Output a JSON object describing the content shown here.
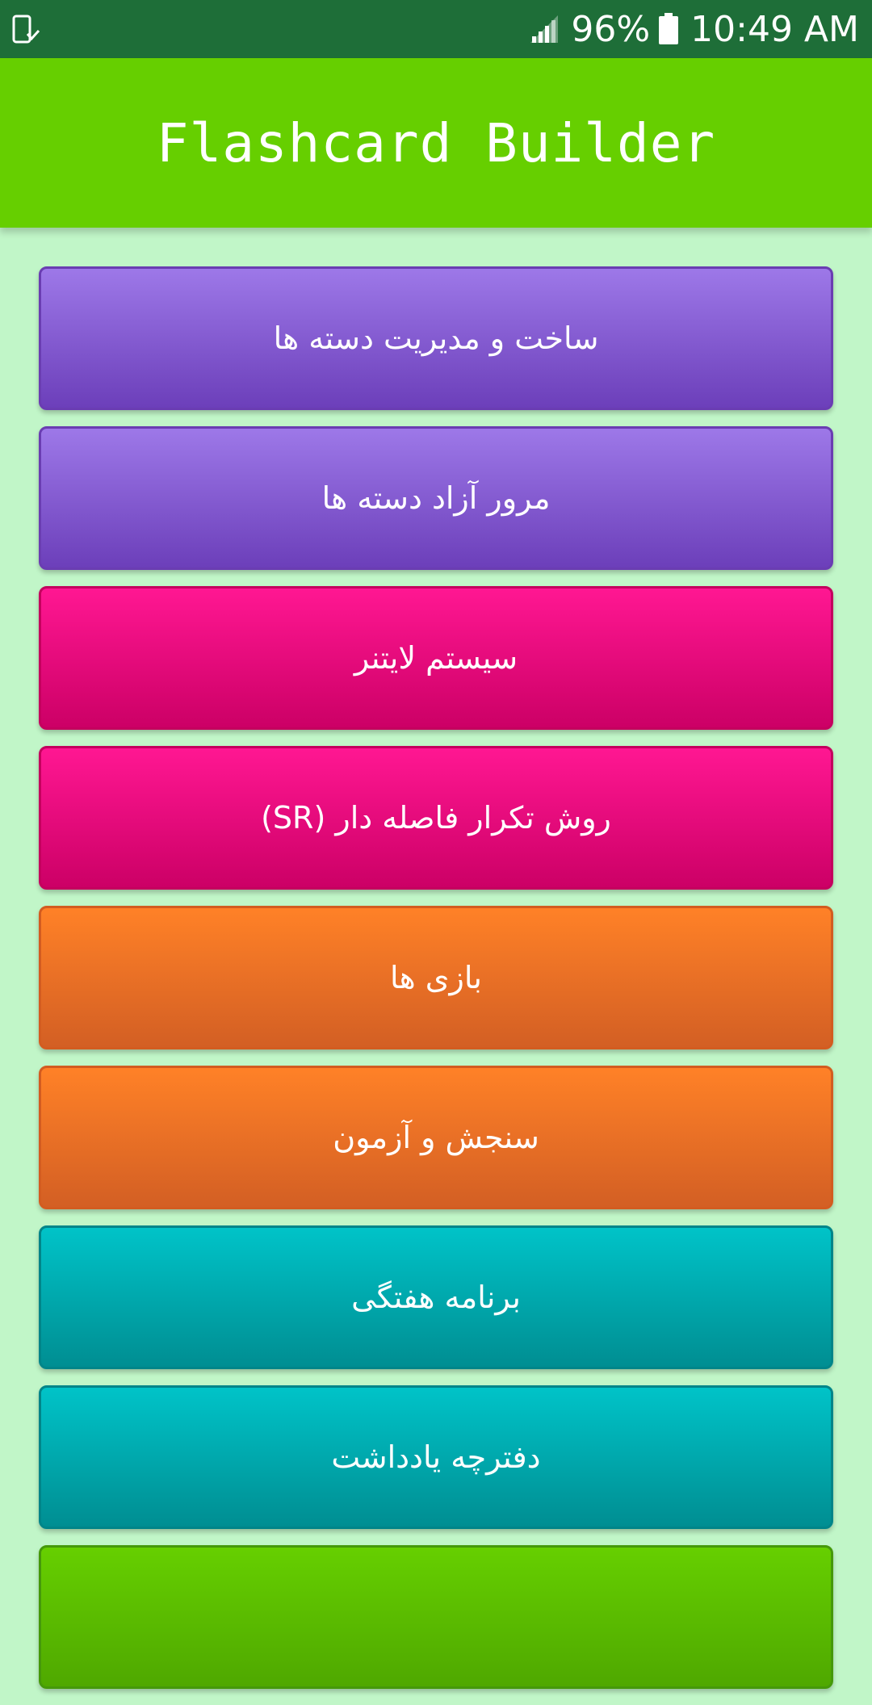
{
  "status_bar": {
    "battery_percent": "96%",
    "time": "10:49 AM",
    "left_icon": "phone-download-icon",
    "signal_icon": "signal-icon",
    "battery_icon": "battery-icon"
  },
  "app_bar": {
    "title": "Flashcard Builder"
  },
  "menu": {
    "items": [
      {
        "label": "ساخت و مدیریت دسته ها",
        "color": "#8a5fd8"
      },
      {
        "label": "مرور آزاد دسته ها",
        "color": "#8a5fd8"
      },
      {
        "label": "سیستم لایتنر",
        "color": "#f2127f"
      },
      {
        "label": "روش تکرار فاصله دار (SR)",
        "color": "#f2127f"
      },
      {
        "label": "بازی ها",
        "color": "#ee7226"
      },
      {
        "label": "سنجش و آزمون",
        "color": "#ee7226"
      },
      {
        "label": "برنامه هفتگی",
        "color": "#00aab0"
      },
      {
        "label": "دفترچه یادداشت",
        "color": "#00aab0"
      }
    ]
  },
  "colors": {
    "status_bar": "#1e6e38",
    "app_bar": "#66cf00",
    "background": "#c1f6c8"
  }
}
